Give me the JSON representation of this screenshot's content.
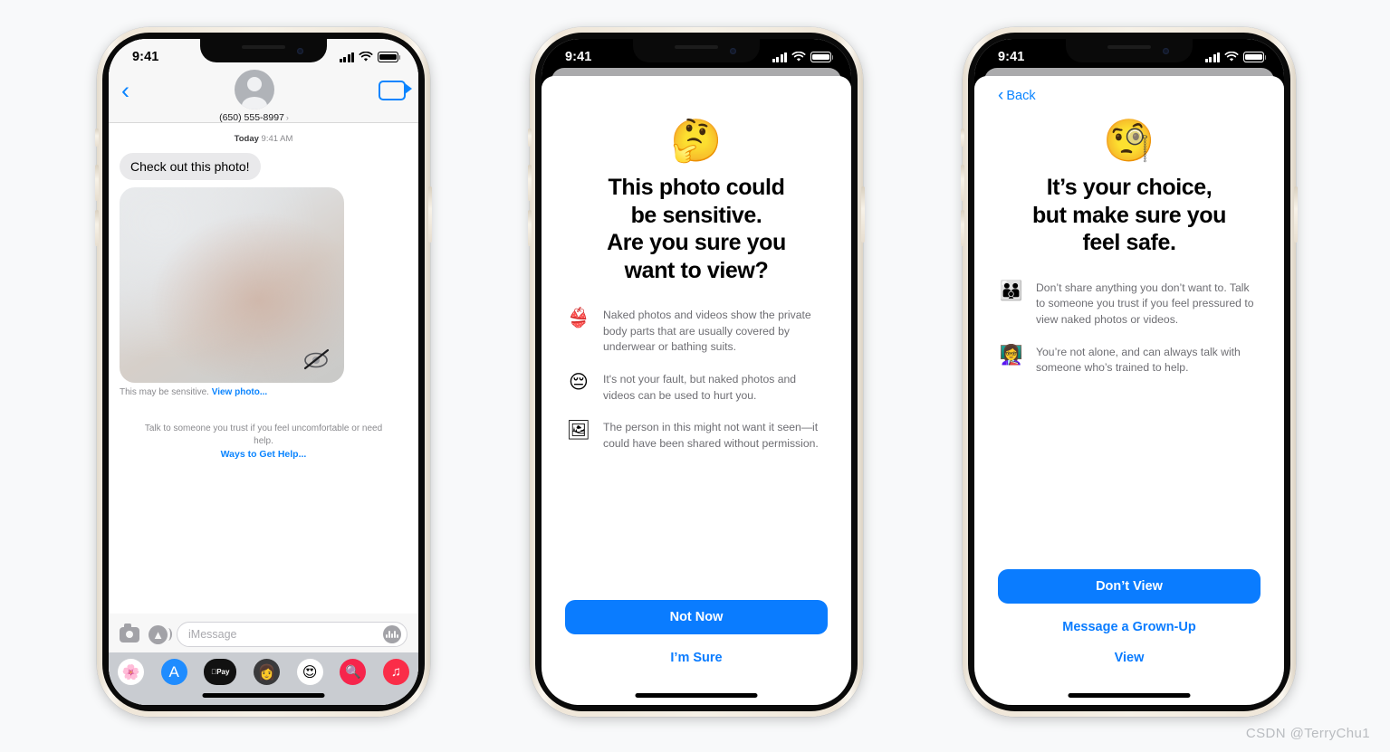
{
  "watermark": "CSDN @TerryChu1",
  "phone1": {
    "status": {
      "time": "9:41",
      "signal_icon": "cellular-bars-icon",
      "wifi_icon": "wifi-icon",
      "battery_icon": "battery-icon"
    },
    "nav": {
      "back_icon": "chevron-left-icon",
      "avatar": "contact-avatar",
      "contact": "(650) 555-8997",
      "disclosure": "›",
      "facetime_icon": "facetime-video-icon"
    },
    "thread": {
      "timestamp_day": "Today",
      "timestamp_time": "9:41 AM",
      "incoming_message": "Check out this photo!",
      "photo_placeholder_icon": "eye-slash-icon",
      "sensitive_caption": "This may be sensitive.",
      "view_photo_link": "View photo...",
      "help_text": "Talk to someone you trust if you feel uncomfortable or need help.",
      "help_link": "Ways to Get Help..."
    },
    "composer": {
      "camera_icon": "camera-icon",
      "apps_icon": "app-store-icon",
      "placeholder": "iMessage",
      "audio_icon": "audio-waveform-icon"
    },
    "app_drawer": [
      {
        "name": "photos-app-icon",
        "glyph": "🌸",
        "bg": "#ffffff"
      },
      {
        "name": "app-store-app-icon",
        "glyph": "🅰",
        "bg": "#1f8cff"
      },
      {
        "name": "apple-pay-app-icon",
        "glyph": "Pay",
        "bg": "#111111"
      },
      {
        "name": "memoji-app-icon",
        "glyph": "👩",
        "bg": "#3a3a3c"
      },
      {
        "name": "memoji-sticker-icon",
        "glyph": "😍",
        "bg": "#ffffff"
      },
      {
        "name": "images-search-app-icon",
        "glyph": "🔍",
        "bg": "#f6254c"
      },
      {
        "name": "music-app-icon",
        "glyph": "♫",
        "bg": "#fa2d48"
      }
    ]
  },
  "phone2": {
    "status": {
      "time": "9:41",
      "signal_icon": "cellular-bars-icon",
      "wifi_icon": "wifi-icon",
      "battery_icon": "battery-icon"
    },
    "hero_emoji": "🤔",
    "title": "This photo could\nbe sensitive.\nAre you sure you\nwant to view?",
    "bullets": [
      {
        "emoji": "👙",
        "icon_name": "swimsuit-shorts-icon",
        "text": "Naked photos and videos show the private body parts that are usually covered by underwear or bathing suits."
      },
      {
        "emoji": "😔",
        "icon_name": "pensive-face-icon",
        "text": "It's not your fault, but naked photos and videos can be used to hurt you."
      },
      {
        "emoji": "🖼",
        "icon_name": "framed-picture-icon",
        "text": "The person in this might not want it seen—it could have been shared without permission."
      }
    ],
    "primary_button": "Not Now",
    "secondary_link": "I’m Sure"
  },
  "phone3": {
    "status": {
      "time": "9:41",
      "signal_icon": "cellular-bars-icon",
      "wifi_icon": "wifi-icon",
      "battery_icon": "battery-icon"
    },
    "back_label": "Back",
    "hero_emoji": "🧐",
    "title": "It’s your choice,\nbut make sure you\nfeel safe.",
    "bullets": [
      {
        "emoji": "👪",
        "icon_name": "family-icon",
        "text": "Don’t share anything you don’t want to. Talk to someone you trust if you feel pressured to view naked photos or videos."
      },
      {
        "emoji": "👩‍🏫",
        "icon_name": "teacher-icon",
        "text": "You’re not alone, and can always talk with someone who’s trained to help."
      }
    ],
    "primary_button": "Don’t View",
    "secondary_link": "Message a Grown-Up",
    "tertiary_link": "View"
  },
  "colors": {
    "accent_blue": "#0a7cff",
    "link_blue": "#0a84ff",
    "bubble_gray": "#e9e9eb",
    "secondary_text": "#6e6e73",
    "page_bg": "#f8f9fa"
  }
}
